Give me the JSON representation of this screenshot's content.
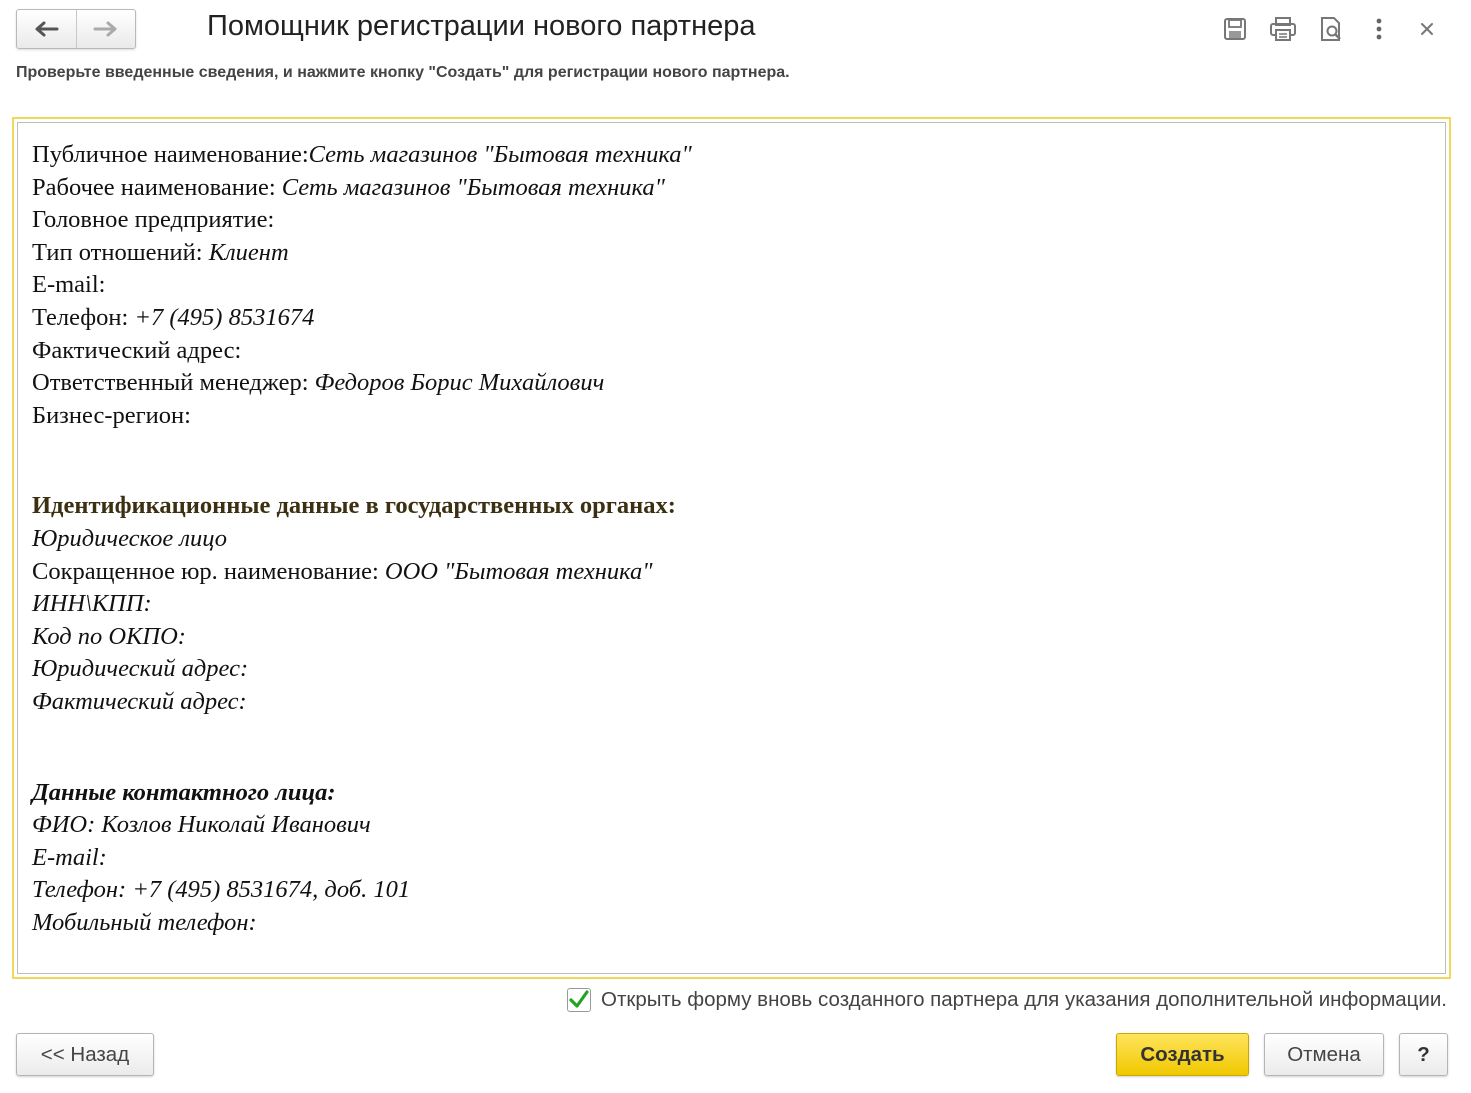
{
  "window": {
    "title": "Помощник регистрации нового партнера",
    "hint": "Проверьте введенные сведения, и нажмите кнопку \"Создать\"  для регистрации нового партнера."
  },
  "toolbar": {
    "icons": [
      "save-icon",
      "print-icon",
      "preview-icon",
      "more-icon",
      "close-icon"
    ],
    "close_glyph": "×"
  },
  "document": {
    "general": [
      {
        "label": "Публичное наименование:",
        "value": "Сеть магазинов \"Бытовая техника\""
      },
      {
        "label": "Рабочее наименование:",
        "value": "Сеть магазинов \"Бытовая техника\""
      },
      {
        "label": "Головное предприятие:",
        "value": ""
      },
      {
        "label": "Тип отношений:",
        "value": "Клиент"
      },
      {
        "label": "E-mail:",
        "value": ""
      },
      {
        "label": "Телефон:",
        "value": "+7 (495) 8531674"
      },
      {
        "label": "Фактический адрес:",
        "value": ""
      },
      {
        "label": "Ответственный менеджер:",
        "value": "Федоров Борис Михайлович"
      },
      {
        "label": "Бизнес-регион:",
        "value": ""
      }
    ],
    "gov_header": "Идентификационные данные в государственных органах:",
    "gov_type": "Юридическое лицо",
    "gov_short_name_label": "Сокращенное юр. наименование:",
    "gov_short_name_value": "ООО \"Бытовая техника\"",
    "gov_inn": "ИНН\\КПП:",
    "gov_okpo": "Код по ОКПО:",
    "gov_legal_address": "Юридический адрес:",
    "gov_actual_address": "Фактический адрес:",
    "contact_header": "Данные контактного лица:",
    "contact_fio": "ФИО: Козлов Николай Иванович",
    "contact_email": "E-mail:",
    "contact_phone": "Телефон: +7 (495) 8531674, доб. 101",
    "contact_mobile": "Мобильный телефон:"
  },
  "open_form_checkbox": {
    "checked": true,
    "label": "Открыть форму вновь созданного партнера для указания дополнительной информации."
  },
  "buttons": {
    "back": "<< Назад",
    "create": "Создать",
    "cancel": "Отмена",
    "help": "?"
  },
  "colors": {
    "accent_yellow": "#f0c800",
    "frame_border": "#f2d85a",
    "check_green": "#1fa51f"
  }
}
